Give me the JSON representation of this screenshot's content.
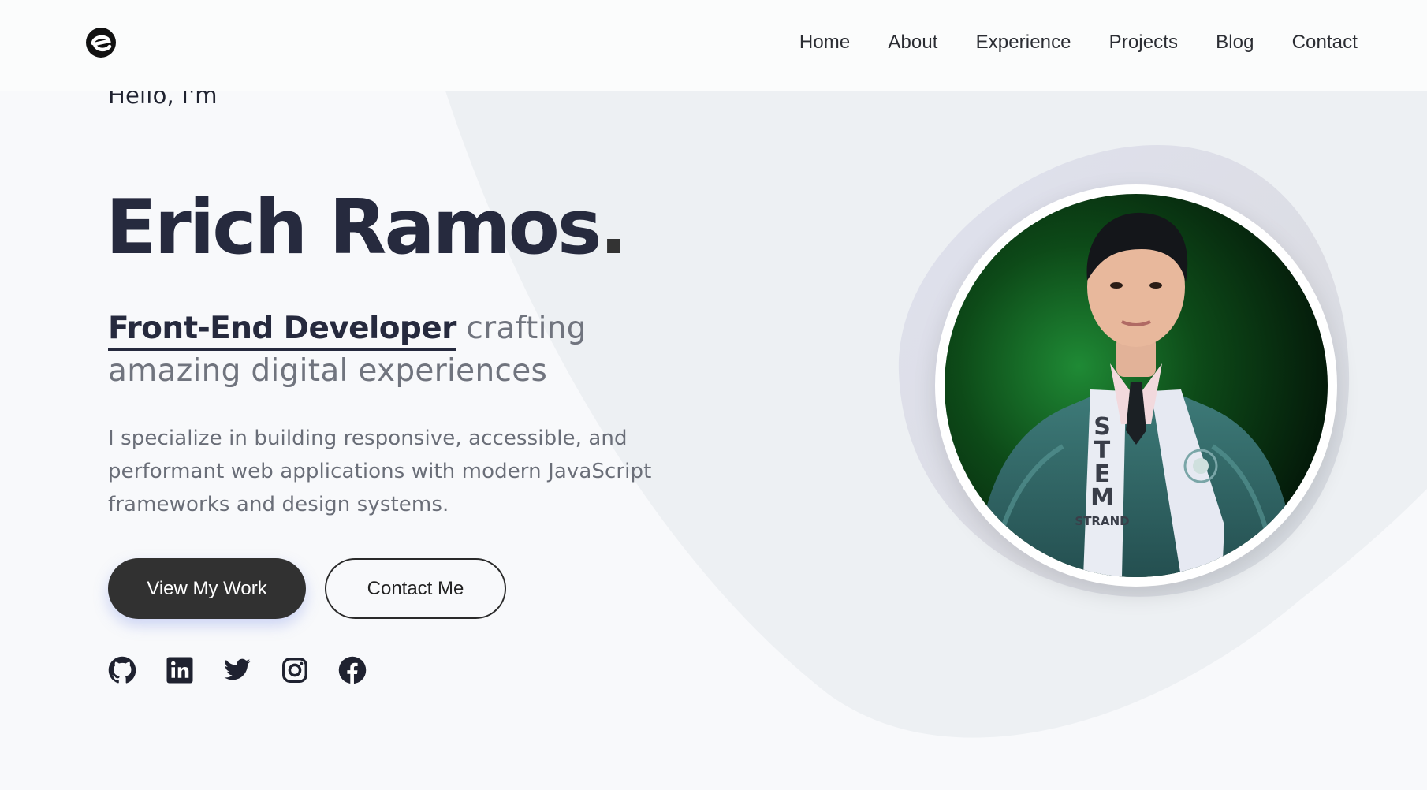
{
  "nav": {
    "items": [
      "Home",
      "About",
      "Experience",
      "Projects",
      "Blog",
      "Contact"
    ]
  },
  "hero": {
    "greeting": "Hello, I'm",
    "name": "Erich Ramos",
    "name_dot": ".",
    "role_highlight": "Front-End Developer",
    "role_rest": " crafting amazing digital experiences",
    "description": "I specialize in building responsive, accessible, and performant web applications with modern JavaScript frameworks and design systems.",
    "primary_button": "View My Work",
    "secondary_button": "Contact Me"
  },
  "portrait": {
    "sash_text": "STEM",
    "sash_subtext": "STRAND"
  },
  "socials": [
    "github-icon",
    "linkedin-icon",
    "twitter-icon",
    "instagram-icon",
    "facebook-icon"
  ],
  "colors": {
    "text_dark": "#262a3e",
    "text_muted": "#70747e",
    "button_dark": "#313131",
    "background": "#f8f9fb"
  }
}
